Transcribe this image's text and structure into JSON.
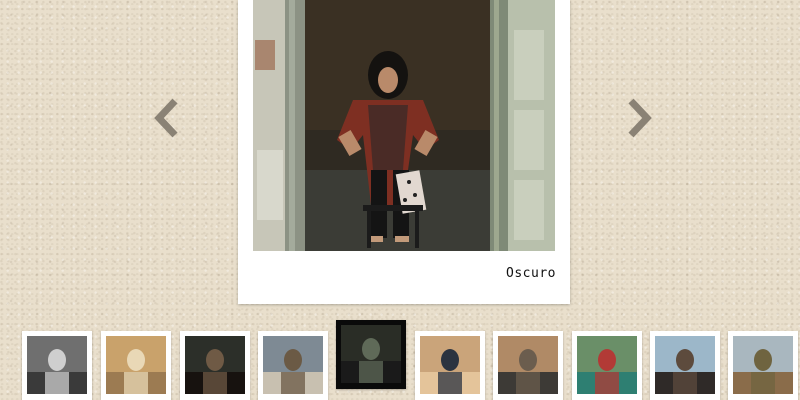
{
  "gallery": {
    "caption": "Oscuro",
    "prev_icon": "chevron-left-icon",
    "next_icon": "chevron-right-icon"
  },
  "thumbnails": [
    {
      "name": "thumbnail-1",
      "colors": [
        "#6f6f6f",
        "#cfcfcf",
        "#3a3a3a"
      ]
    },
    {
      "name": "thumbnail-2",
      "colors": [
        "#c9a26b",
        "#e9d8b6",
        "#9c7b52"
      ]
    },
    {
      "name": "thumbnail-3",
      "colors": [
        "#2c2f29",
        "#6f5a45",
        "#17120f"
      ]
    },
    {
      "name": "thumbnail-4",
      "colors": [
        "#7e8a94",
        "#6b5a45",
        "#c8c0b0"
      ]
    },
    {
      "name": "thumbnail-5",
      "colors": [
        "#2a2d26",
        "#5f6a58",
        "#1a1a1a"
      ],
      "active": true
    },
    {
      "name": "thumbnail-6",
      "colors": [
        "#caa47a",
        "#2b3340",
        "#e4c49a"
      ]
    },
    {
      "name": "thumbnail-7",
      "colors": [
        "#b08a66",
        "#6b5d4e",
        "#3d3a36"
      ]
    },
    {
      "name": "thumbnail-8",
      "colors": [
        "#6a8f68",
        "#b23a36",
        "#2e7f72"
      ]
    },
    {
      "name": "thumbnail-9",
      "colors": [
        "#9cb7c9",
        "#5d4b3d",
        "#2f2a28"
      ]
    },
    {
      "name": "thumbnail-10",
      "colors": [
        "#a9b7bf",
        "#6f6440",
        "#8a6c4a"
      ]
    }
  ]
}
